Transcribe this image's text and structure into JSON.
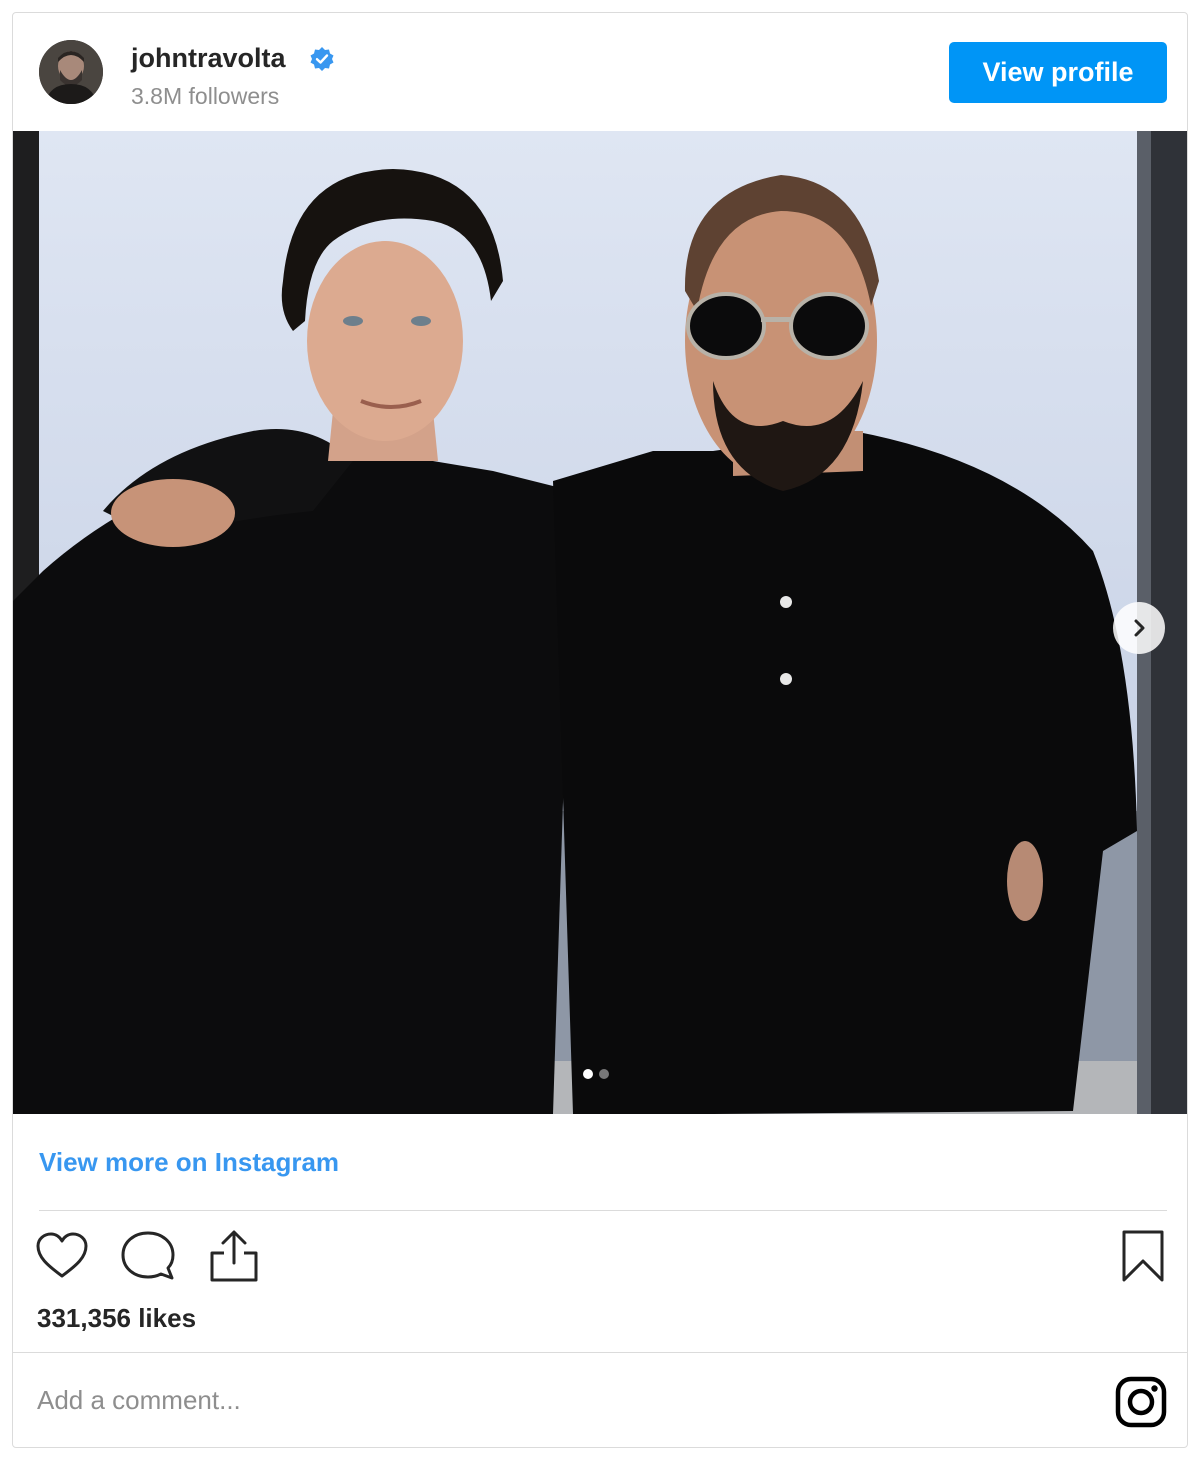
{
  "header": {
    "username": "johntravolta",
    "followers": "3.8M followers",
    "view_profile_label": "View profile",
    "verified_icon": "verified-badge-icon"
  },
  "post": {
    "carousel_total": 2,
    "carousel_active": 1,
    "view_more_label": "View more on Instagram",
    "likes": "331,356 likes",
    "comment_placeholder": "Add a comment..."
  },
  "colors": {
    "accent": "#0095f6",
    "link": "#3897f0",
    "muted": "#8e8e8e",
    "border": "#dbdbdb"
  },
  "icons": [
    "heart-icon",
    "comment-icon",
    "share-icon",
    "bookmark-icon",
    "instagram-logo-icon",
    "chevron-right-icon"
  ]
}
